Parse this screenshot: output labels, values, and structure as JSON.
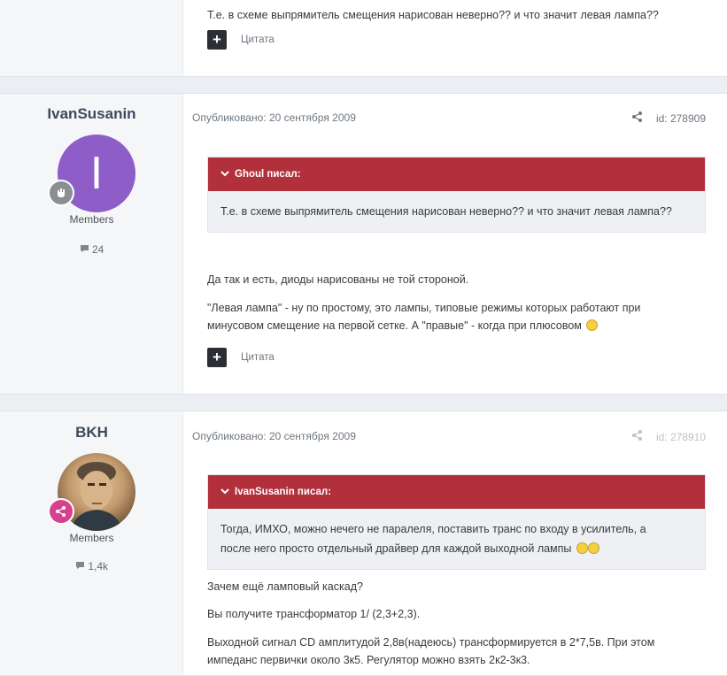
{
  "posts": [
    {
      "lines": [
        "Т.е. в схеме выпрямитель смещения нарисован неверно?? и что значит левая лампа??"
      ],
      "plus_label": "+",
      "cite_label": "Цитата"
    },
    {
      "author": "IvanSusanin",
      "avatar_letter": "I",
      "group": "Members",
      "post_count": "24",
      "date": "Опубликовано: 20 сентября 2009",
      "post_id": "id: 278909",
      "quote_author": "Ghoul писал:",
      "quote_text": "Т.е. в схеме выпрямитель смещения нарисован неверно?? и что значит левая лампа??",
      "para1": "Да так и есть, диоды нарисованы не той стороной.",
      "para2_line1": "\"Левая лампа\" - ну по простому, это лампы, типовые режимы которых работают при",
      "para2_line2": "минусовом смещение на первой сетке. А \"правые\" - когда при плюсовом",
      "plus_label": "+",
      "cite_label": "Цитата"
    },
    {
      "author": "BKH",
      "group": "Members",
      "post_count": "1,4k",
      "date": "Опубликовано: 20 сентября 2009",
      "post_id": "id: 278910",
      "quote_author": "IvanSusanin писал:",
      "quote_line1": "Тогда, ИМХО, можно нечего не паралеля, поставить транс по входу в усилитель, а",
      "quote_line2": "после него просто отдельный драйвер для каждой выходной лампы",
      "para1": "Зачем ещё ламповый каскад?",
      "para2": "Вы получите трансформатор 1/ (2,3+2,3).",
      "para3_line1": "Выходной сигнал CD амплитудой 2,8в(надеюсь) трансформируется в 2*7,5в. При этом",
      "para3_line2": "импеданс первички около 3к5. Регулятор можно взять 2к2-3к3."
    }
  ],
  "icons": {
    "quote_toggle": "chevron-down-icon",
    "share": "share-icon",
    "comments": "comment-icon",
    "rank": "rank-badge-icon"
  },
  "colors": {
    "quote_header": "#b1303c",
    "avatar_purple": "#8e5dc8",
    "badge_pink": "#d6408f",
    "badge_gray": "#8a8f94"
  }
}
